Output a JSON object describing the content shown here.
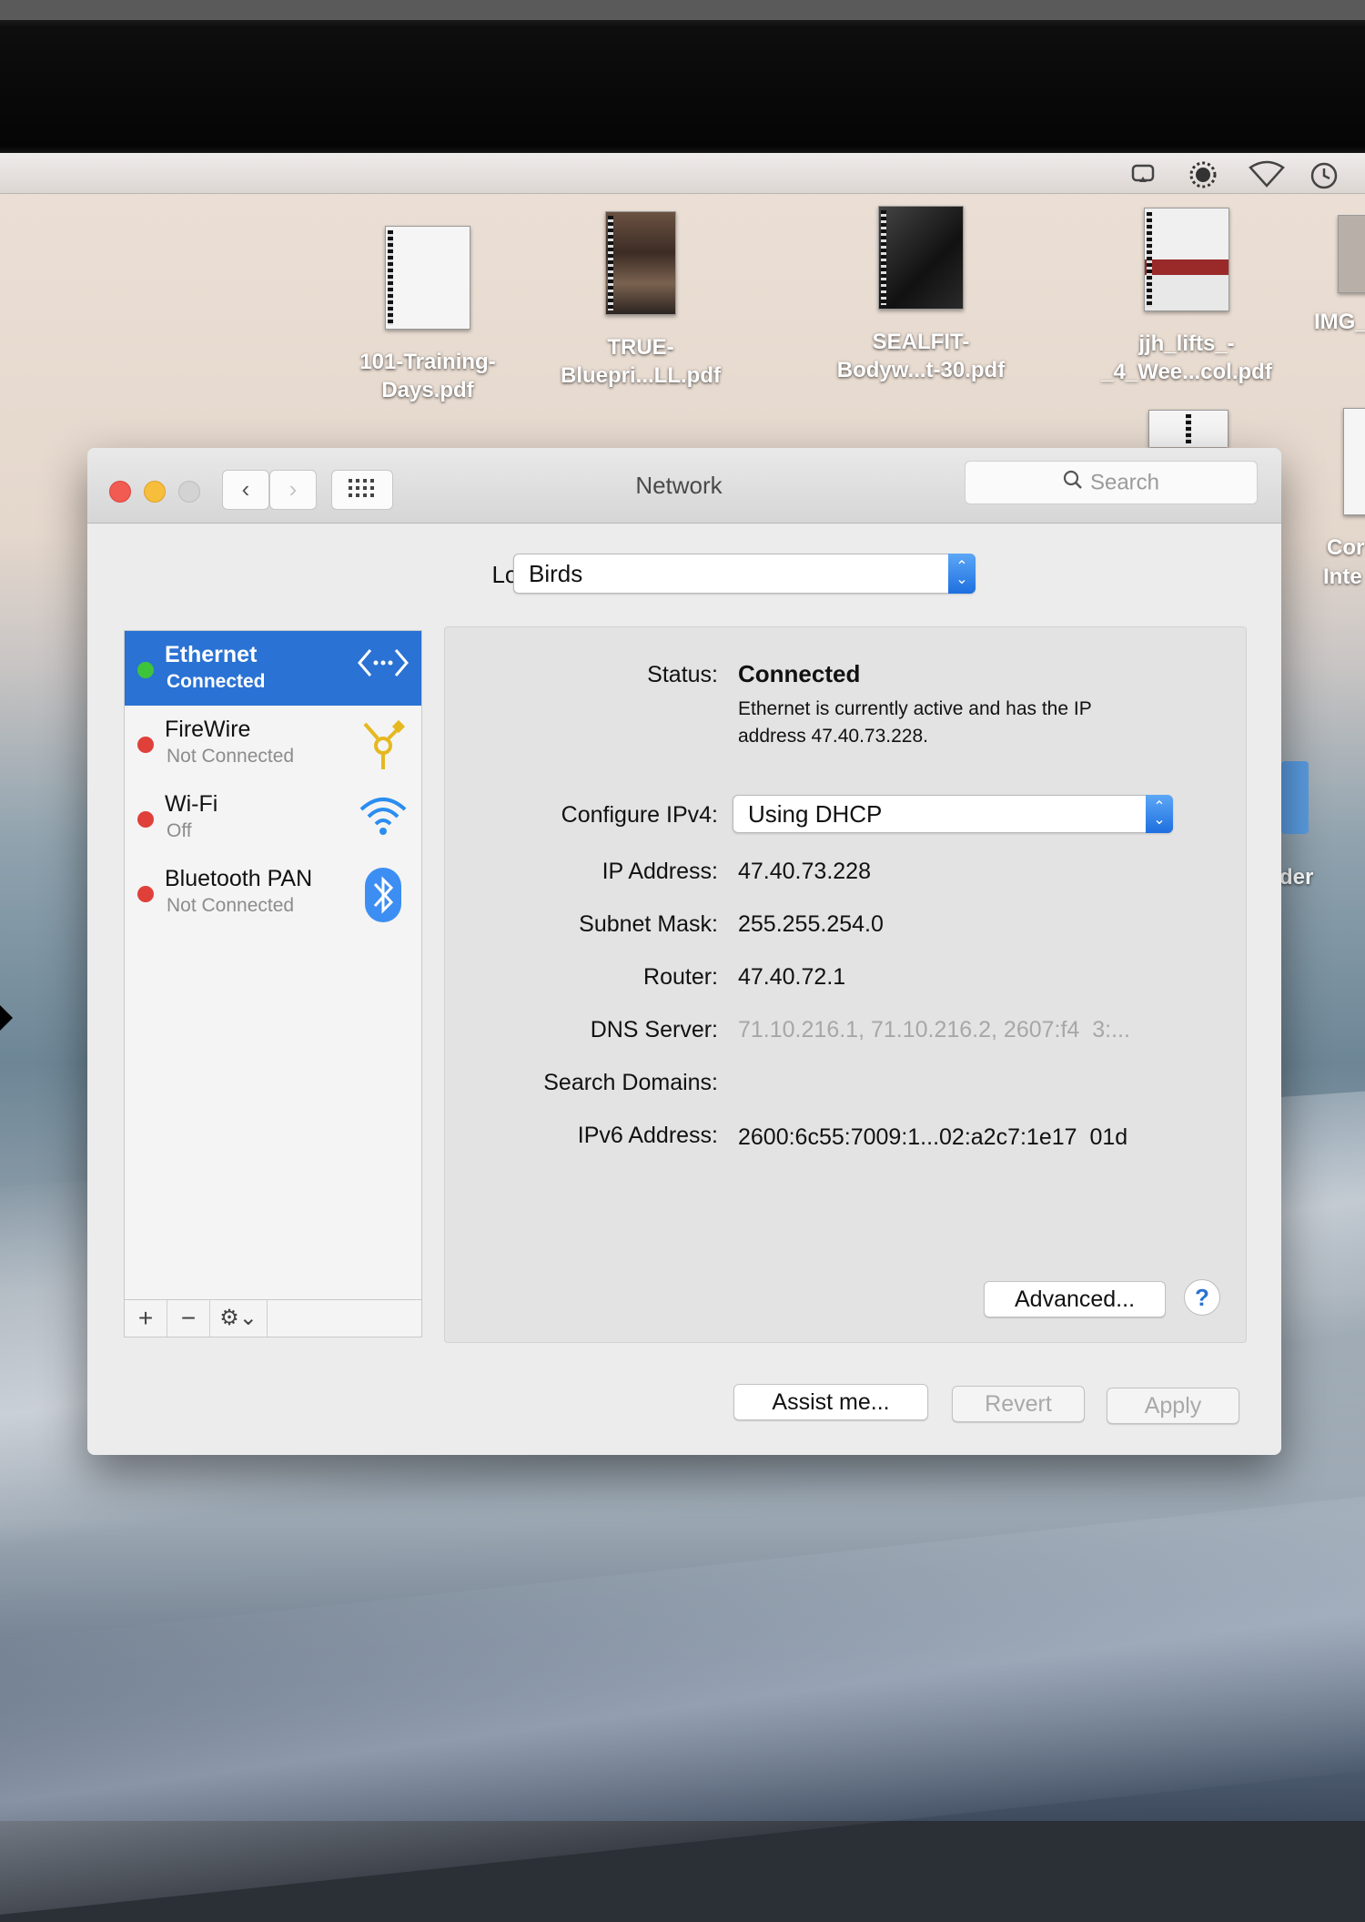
{
  "menubar": {
    "icons": [
      "airplay-icon",
      "brightness-icon",
      "wifi-icon",
      "time-machine-icon"
    ]
  },
  "desktop": {
    "files": [
      {
        "label": "101-Training-\nDays.pdf"
      },
      {
        "label": "TRUE-\nBluepri...LL.pdf"
      },
      {
        "label": "SEALFIT-\nBodyw...t-30.pdf"
      },
      {
        "label": "jjh_lifts_-\n_4_Wee...col.pdf"
      },
      {
        "label": "IMG_"
      }
    ],
    "peek_labels": [
      "Cor",
      "Inte",
      "der"
    ]
  },
  "window": {
    "title": "Network",
    "search_placeholder": "Search",
    "location_label": "Location:",
    "location_value": "Birds",
    "services": [
      {
        "name": "Ethernet",
        "status": "Connected",
        "status_color": "#3ec43a",
        "icon": "ethernet-icon",
        "selected": true
      },
      {
        "name": "FireWire",
        "status": "Not Connected",
        "status_color": "#e0403a",
        "icon": "firewire-icon"
      },
      {
        "name": "Wi-Fi",
        "status": "Off",
        "status_color": "#e0403a",
        "icon": "wifi-icon"
      },
      {
        "name": "Bluetooth PAN",
        "status": "Not Connected",
        "status_color": "#e0403a",
        "icon": "bluetooth-icon"
      }
    ],
    "detail": {
      "status_label": "Status:",
      "status_value": "Connected",
      "status_desc_line1": "Ethernet is currently active and has the IP",
      "status_desc_line2": "address 47.40.73.228.",
      "configure_label": "Configure IPv4:",
      "configure_value": "Using DHCP",
      "ip_label": "IP Address:",
      "ip_value": "47.40.73.228",
      "subnet_label": "Subnet Mask:",
      "subnet_value": "255.255.254.0",
      "router_label": "Router:",
      "router_value": "47.40.72.1",
      "dns_label": "DNS Server:",
      "dns_value": "71.10.216.1, 71.10.216.2, 2607:f4  3:...",
      "search_domains_label": "Search Domains:",
      "ipv6_label": "IPv6 Address:",
      "ipv6_value": "2600:6c55:7009:1...02:a2c7:1e17  01d",
      "advanced_button": "Advanced...",
      "help_button": "?"
    },
    "buttons": {
      "assist": "Assist me...",
      "revert": "Revert",
      "apply": "Apply"
    },
    "sidebar_toolbar": {
      "add": "+",
      "remove": "−",
      "gear": "⚙︎⌄"
    }
  },
  "colors": {
    "accent": "#2a72d3",
    "connected": "#3ec43a",
    "disconnected": "#e0403a"
  }
}
